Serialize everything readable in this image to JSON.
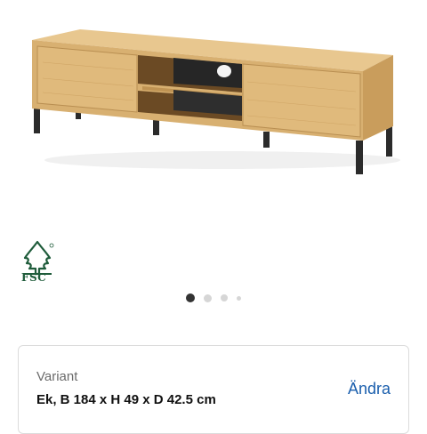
{
  "product": {
    "image_alt": "TV-bänk i ek med svarta ben",
    "fsc_label": "FSC",
    "fsc_color": "#1f5c3b"
  },
  "carousel": {
    "total": 4,
    "active_index": 0
  },
  "variant": {
    "label": "Variant",
    "value": "Ek, B 184 x H 49 x D 42.5 cm",
    "change_label": "Ändra",
    "accent_color": "#1b5fad"
  }
}
